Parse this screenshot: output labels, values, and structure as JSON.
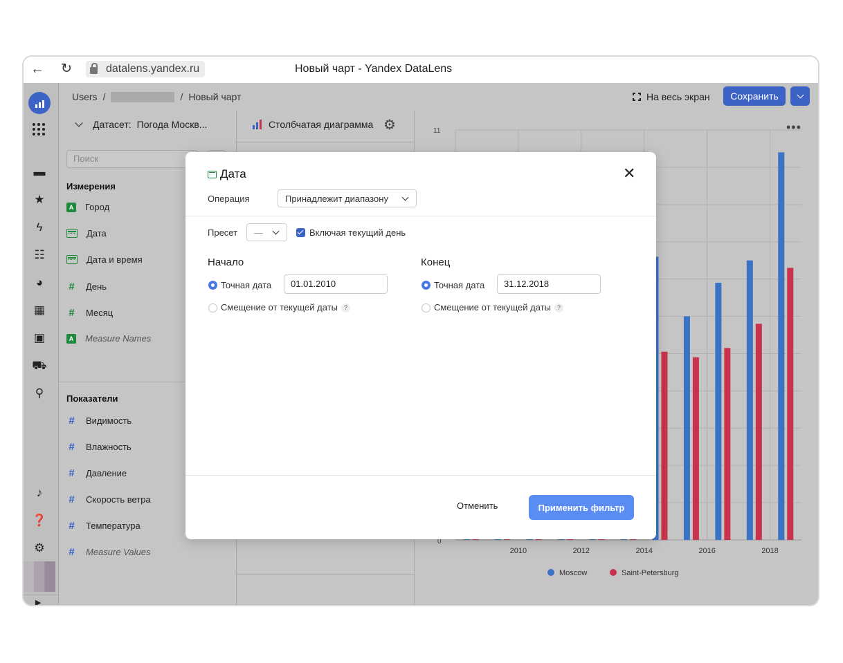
{
  "browser": {
    "url": "datalens.yandex.ru",
    "title": "Новый чарт - Yandex DataLens"
  },
  "topbar": {
    "breadcrumb": {
      "root": "Users",
      "sep": "/",
      "current": "Новый чарт"
    },
    "fullscreen_label": "На весь экран",
    "save_label": "Сохранить"
  },
  "nav_icons": [
    "logo-icon",
    "apps-grid-icon",
    "folder-icon",
    "star-icon",
    "bolt-icon",
    "list-icon",
    "pie-icon",
    "dashboard-icon",
    "dataset-icon",
    "cart-icon",
    "settings-slider-icon",
    "bell-icon",
    "help-icon",
    "gear-icon",
    "avatar",
    "expand-icon"
  ],
  "dataset": {
    "prefix": "Датасет:",
    "name": "Погода Москв..."
  },
  "search": {
    "placeholder": "Поиск"
  },
  "dimensions": {
    "title": "Измерения",
    "items": [
      {
        "label": "Город",
        "type": "string"
      },
      {
        "label": "Дата",
        "type": "date"
      },
      {
        "label": "Дата и время",
        "type": "datetime"
      },
      {
        "label": "День",
        "type": "number"
      },
      {
        "label": "Месяц",
        "type": "number"
      },
      {
        "label": "Measure Names",
        "type": "string"
      }
    ]
  },
  "measures": {
    "title": "Показатели",
    "items": [
      {
        "label": "Видимость"
      },
      {
        "label": "Влажность"
      },
      {
        "label": "Давление"
      },
      {
        "label": "Скорость ветра"
      },
      {
        "label": "Температура"
      },
      {
        "label": "Measure Values"
      }
    ]
  },
  "chart_type": {
    "label": "Столбчатая диаграмма"
  },
  "chart_data": {
    "type": "bar",
    "ylim": [
      0,
      11
    ],
    "ytick_labels": [
      "11",
      "0"
    ],
    "x": [
      2009,
      2010,
      2011,
      2012,
      2013,
      2014,
      2015,
      2016,
      2017,
      2018,
      2019
    ],
    "xtick_labels": [
      "2010",
      "2012",
      "2014",
      "2016",
      "2018"
    ],
    "series": [
      {
        "name": "Moscow",
        "color": "#3b73c4",
        "values": [
          0.05,
          0.05,
          0.05,
          0.05,
          0.05,
          0.05,
          7.6,
          6.0,
          6.9,
          7.5,
          10.4
        ]
      },
      {
        "name": "Saint-Petersburg",
        "color": "#c8324d",
        "values": [
          0.05,
          0.05,
          0.05,
          0.05,
          0.05,
          0.05,
          5.05,
          4.9,
          5.15,
          5.8,
          7.3
        ]
      }
    ],
    "grid": true,
    "legend": "bottom"
  },
  "modal": {
    "title": "Дата",
    "operation_label": "Операция",
    "operation_value": "Принадлежит диапазону",
    "preset_label": "Пресет",
    "preset_value": "—",
    "include_today_label": "Включая текущий день",
    "start": {
      "title": "Начало",
      "exact_label": "Точная дата",
      "exact_value": "01.01.2010",
      "offset_label": "Смещение от текущей даты"
    },
    "end": {
      "title": "Конец",
      "exact_label": "Точная дата",
      "exact_value": "31.12.2018",
      "offset_label": "Смещение от текущей даты"
    },
    "help_mark": "?",
    "cancel_label": "Отменить",
    "apply_label": "Применить фильтр"
  }
}
